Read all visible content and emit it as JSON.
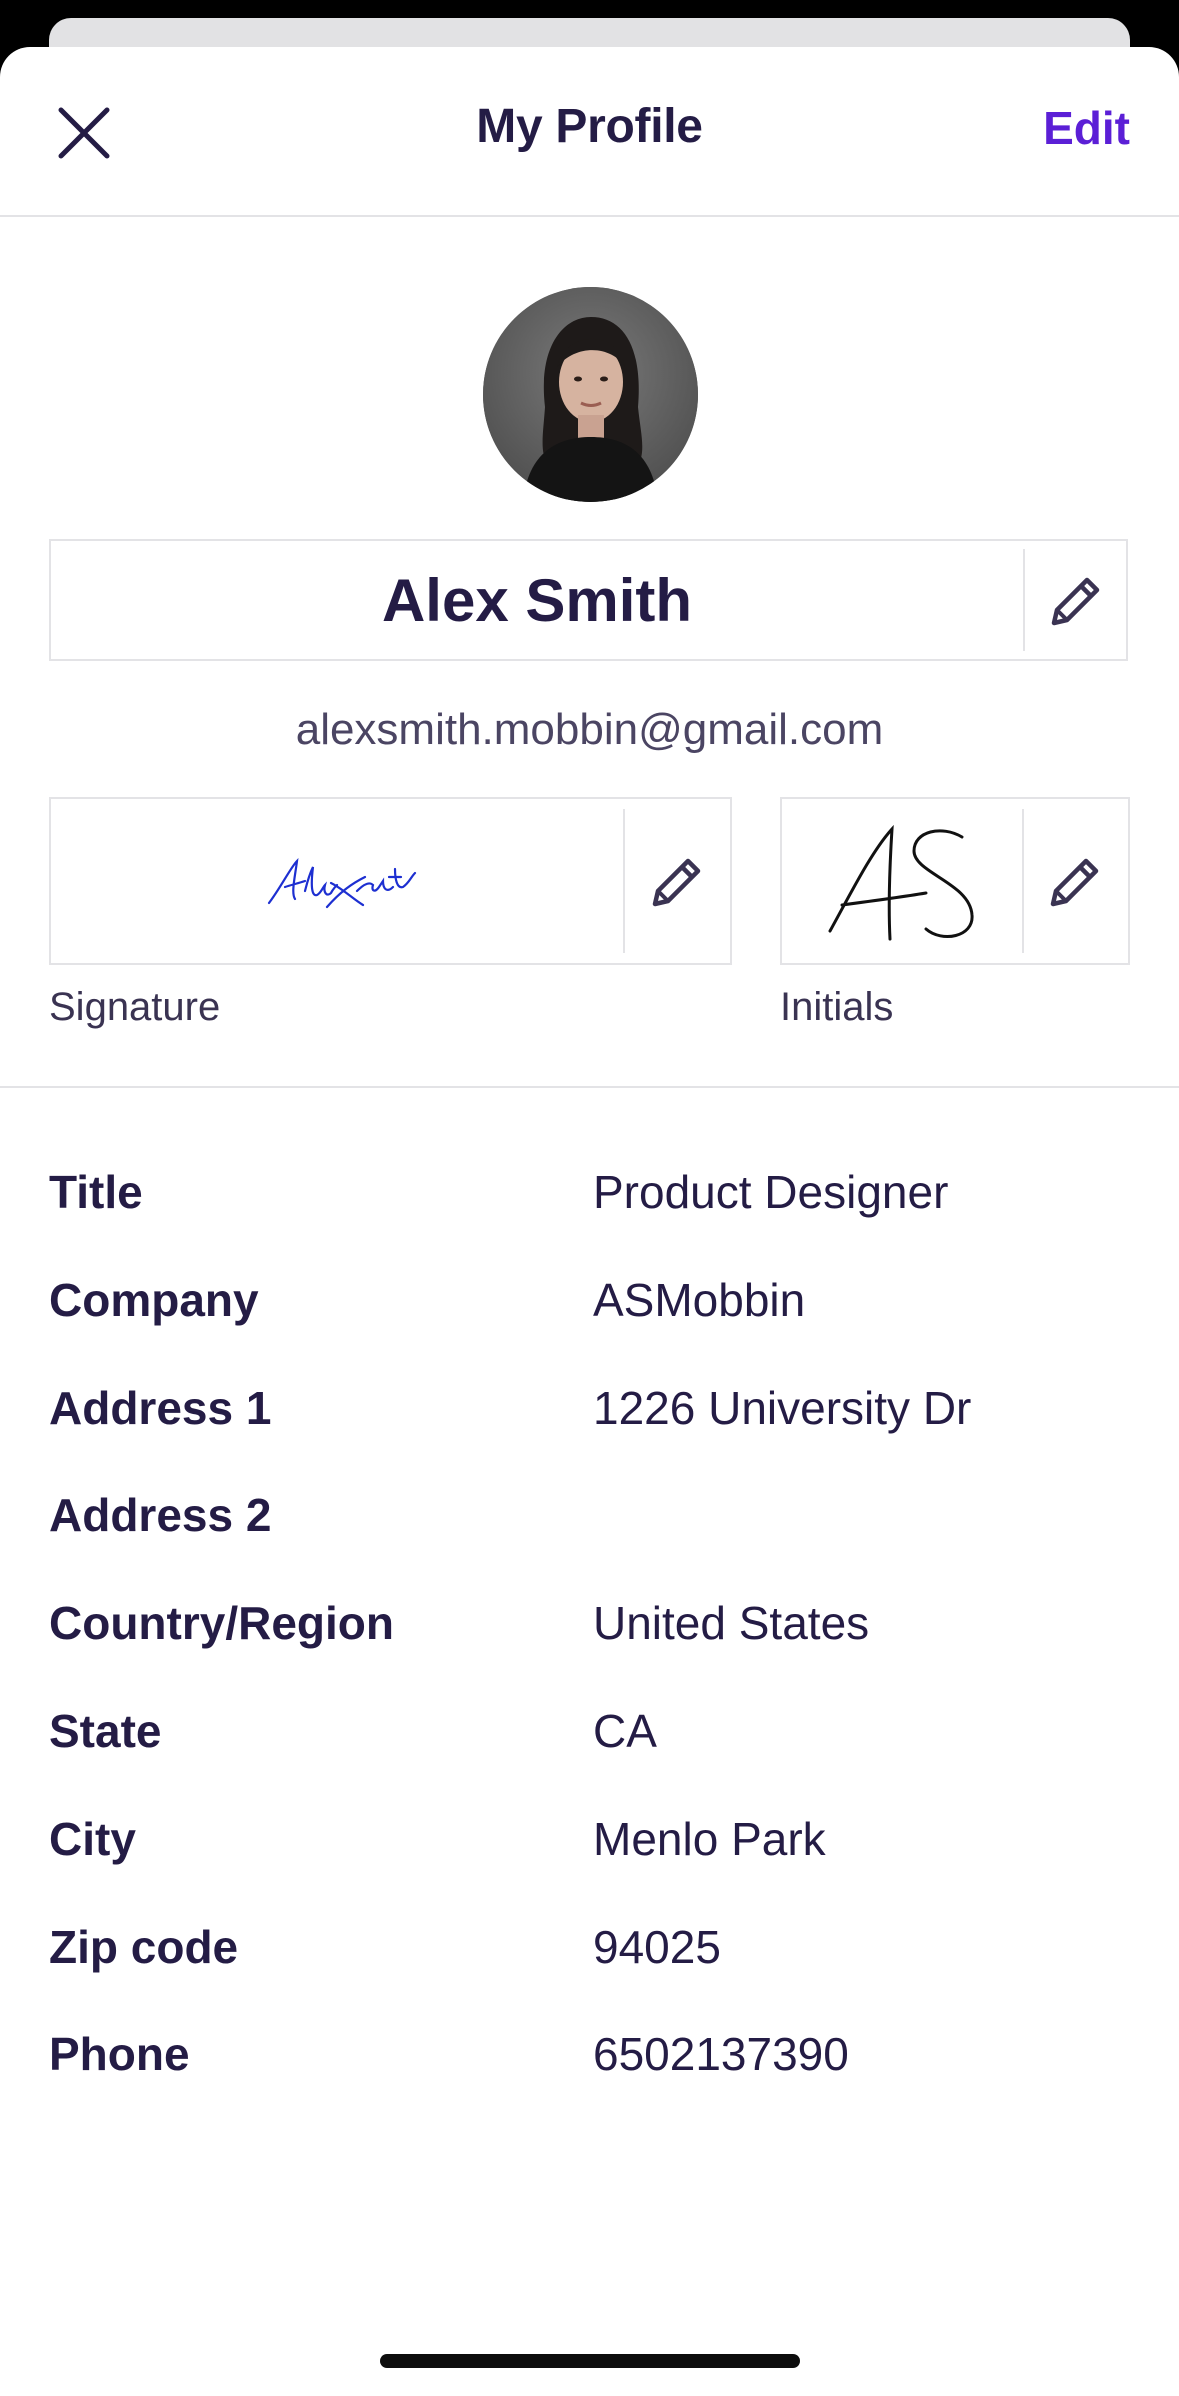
{
  "header": {
    "title": "My Profile",
    "edit_label": "Edit",
    "accent_color": "#5b1fd6"
  },
  "profile": {
    "name": "Alex Smith",
    "email": "alexsmith.mobbin@gmail.com"
  },
  "signature": {
    "label": "Signature",
    "ink_color": "#1d2fd1"
  },
  "initials": {
    "label": "Initials"
  },
  "details": [
    {
      "label": "Title",
      "value": "Product Designer"
    },
    {
      "label": "Company",
      "value": "ASMobbin"
    },
    {
      "label": "Address 1",
      "value": "1226 University Dr"
    },
    {
      "label": "Address 2",
      "value": ""
    },
    {
      "label": "Country/Region",
      "value": "United States"
    },
    {
      "label": "State",
      "value": "CA"
    },
    {
      "label": "City",
      "value": "Menlo Park"
    },
    {
      "label": "Zip code",
      "value": "94025"
    },
    {
      "label": "Phone",
      "value": "6502137390"
    }
  ]
}
